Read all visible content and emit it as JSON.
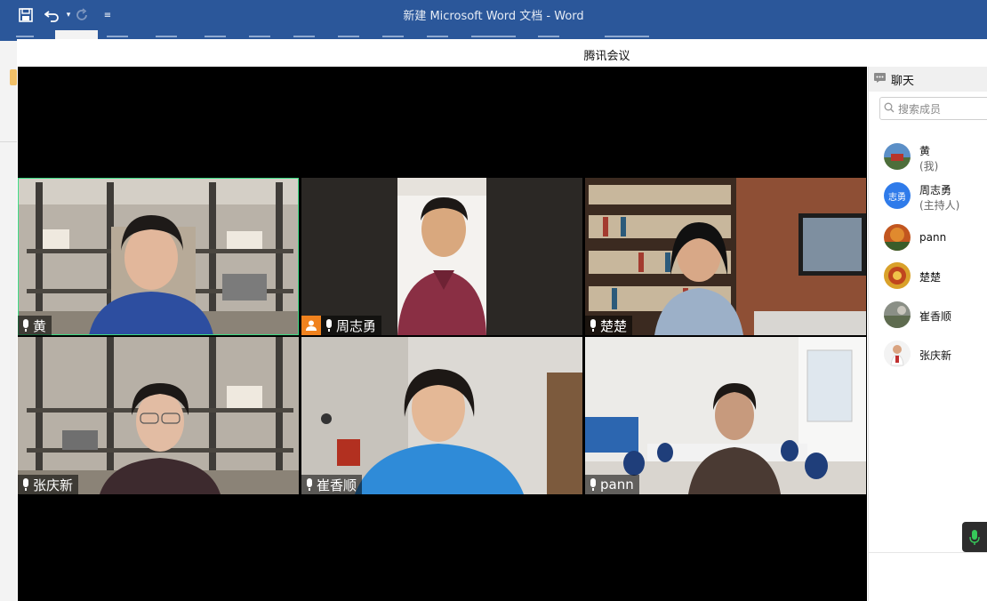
{
  "word": {
    "title": "新建 Microsoft Word 文档  -  Word",
    "accent": "#2b579a"
  },
  "meeting": {
    "title": "腾讯会议"
  },
  "tiles": [
    {
      "name": "黄",
      "active": true,
      "mic": "mic-icon"
    },
    {
      "name": "周志勇",
      "host_badge": true,
      "mic": "mic-icon"
    },
    {
      "name": "楚楚",
      "mic": "mic-icon"
    },
    {
      "name": "张庆新",
      "mic": "mic-icon"
    },
    {
      "name": "崔香顺",
      "mic": "mic-icon"
    },
    {
      "name": "pann",
      "mic": "mic-icon"
    }
  ],
  "sidebar": {
    "chat_label": "聊天",
    "search_placeholder": "搜索成员",
    "members": [
      {
        "name": "黄",
        "role": "(我)"
      },
      {
        "name": "周志勇",
        "role": "(主持人)",
        "avatar_text": "志勇"
      },
      {
        "name": "pann"
      },
      {
        "name": "楚楚"
      },
      {
        "name": "崔香顺"
      },
      {
        "name": "张庆新"
      }
    ]
  }
}
